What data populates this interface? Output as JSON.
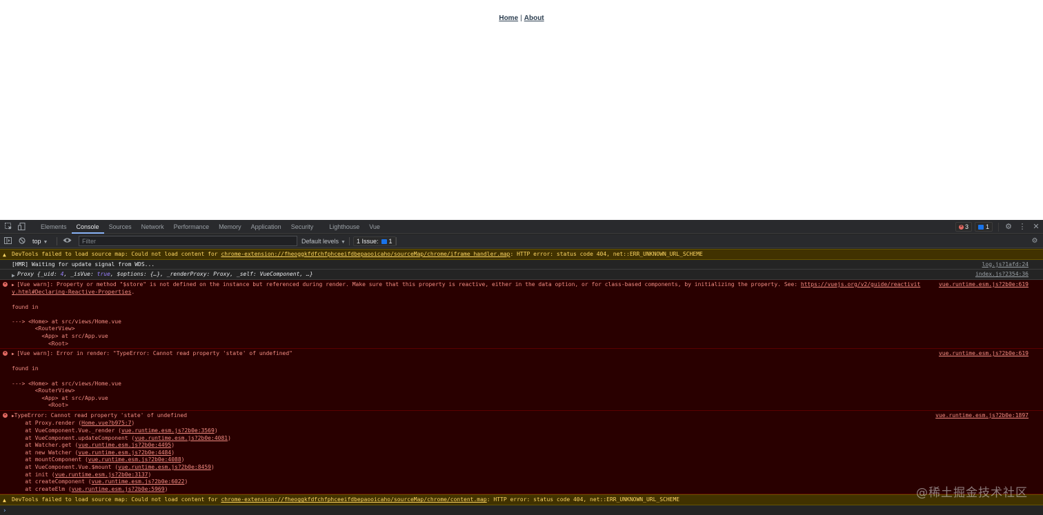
{
  "nav": {
    "home": "Home",
    "separator": "|",
    "about": "About"
  },
  "devtools": {
    "tabs": [
      "Elements",
      "Console",
      "Sources",
      "Network",
      "Performance",
      "Memory",
      "Application",
      "Security",
      "Lighthouse",
      "Vue"
    ],
    "active_tab": "Console",
    "error_count": "3",
    "message_count": "1",
    "context": "top",
    "filter_placeholder": "Filter",
    "levels": "Default levels",
    "issues": "1 Issue:",
    "issues_count": "1"
  },
  "console": {
    "warn1": {
      "prefix": "DevTools failed to load source map: Could not load content for ",
      "link": "chrome-extension://fheoggkfdfchfphceeifdbepaooicaho/sourceMap/chrome/iframe_handler.map",
      "suffix": ": HTTP error: status code 404, net::ERR_UNKNOWN_URL_SCHEME"
    },
    "hmr": {
      "text": "[HMR] Waiting for update signal from WDS...",
      "source": "log.js?1afd:24"
    },
    "proxy": {
      "label": "Proxy",
      "p1": " {_uid: ",
      "uid": "4",
      "p2": ", _isVue: ",
      "isvue": "true",
      "p3": ", $options: {…}, _renderProxy: Proxy, _self: VueComponent, …}",
      "source": "index.js?2354:36"
    },
    "err1": {
      "text": "[Vue warn]: Property or method \"$store\" is not defined on the instance but referenced during render. Make sure that this property is reactive, either in the data option, or for class-based components, by initializing the property. See: ",
      "link": "https://vuejs.org/v2/guide/reactivit",
      "link2": "y.html#Declaring-Reactive-Properties",
      "link2_suffix": ".",
      "found": "found in",
      "tree": [
        "---> <Home> at src/views/Home.vue",
        "       <RouterView>",
        "         <App> at src/App.vue",
        "           <Root>"
      ],
      "source": "vue.runtime.esm.js?2b0e:619"
    },
    "err2": {
      "text": "[Vue warn]: Error in render: \"TypeError: Cannot read property 'state' of undefined\"",
      "found": "found in",
      "tree": [
        "---> <Home> at src/views/Home.vue",
        "       <RouterView>",
        "         <App> at src/App.vue",
        "           <Root>"
      ],
      "source": "vue.runtime.esm.js?2b0e:619"
    },
    "err3": {
      "text": "TypeError: Cannot read property 'state' of undefined",
      "stack": [
        {
          "fn": "    at Proxy.render (",
          "loc": "Home.vue?b975:7",
          "end": ")"
        },
        {
          "fn": "    at VueComponent.Vue._render (",
          "loc": "vue.runtime.esm.js?2b0e:3569",
          "end": ")"
        },
        {
          "fn": "    at VueComponent.updateComponent (",
          "loc": "vue.runtime.esm.js?2b0e:4081",
          "end": ")"
        },
        {
          "fn": "    at Watcher.get (",
          "loc": "vue.runtime.esm.js?2b0e:4495",
          "end": ")"
        },
        {
          "fn": "    at new Watcher (",
          "loc": "vue.runtime.esm.js?2b0e:4484",
          "end": ")"
        },
        {
          "fn": "    at mountComponent (",
          "loc": "vue.runtime.esm.js?2b0e:4088",
          "end": ")"
        },
        {
          "fn": "    at VueComponent.Vue.$mount (",
          "loc": "vue.runtime.esm.js?2b0e:8459",
          "end": ")"
        },
        {
          "fn": "    at init (",
          "loc": "vue.runtime.esm.js?2b0e:3137",
          "end": ")"
        },
        {
          "fn": "    at createComponent (",
          "loc": "vue.runtime.esm.js?2b0e:6022",
          "end": ")"
        },
        {
          "fn": "    at createElm (",
          "loc": "vue.runtime.esm.js?2b0e:5969",
          "end": ")"
        }
      ],
      "source": "vue.runtime.esm.js?2b0e:1897"
    },
    "warn2": {
      "prefix": "DevTools failed to load source map: Could not load content for ",
      "link": "chrome-extension://fheoggkfdfchfphceeifdbepaooicaho/sourceMap/chrome/content.map",
      "suffix": ": HTTP error: status code 404, net::ERR_UNKNOWN_URL_SCHEME"
    }
  },
  "watermark": "@稀土掘金技术社区",
  "colors": {
    "warn_bg": "#413200",
    "error_bg": "#290000",
    "accent": "#8ab4f8"
  }
}
